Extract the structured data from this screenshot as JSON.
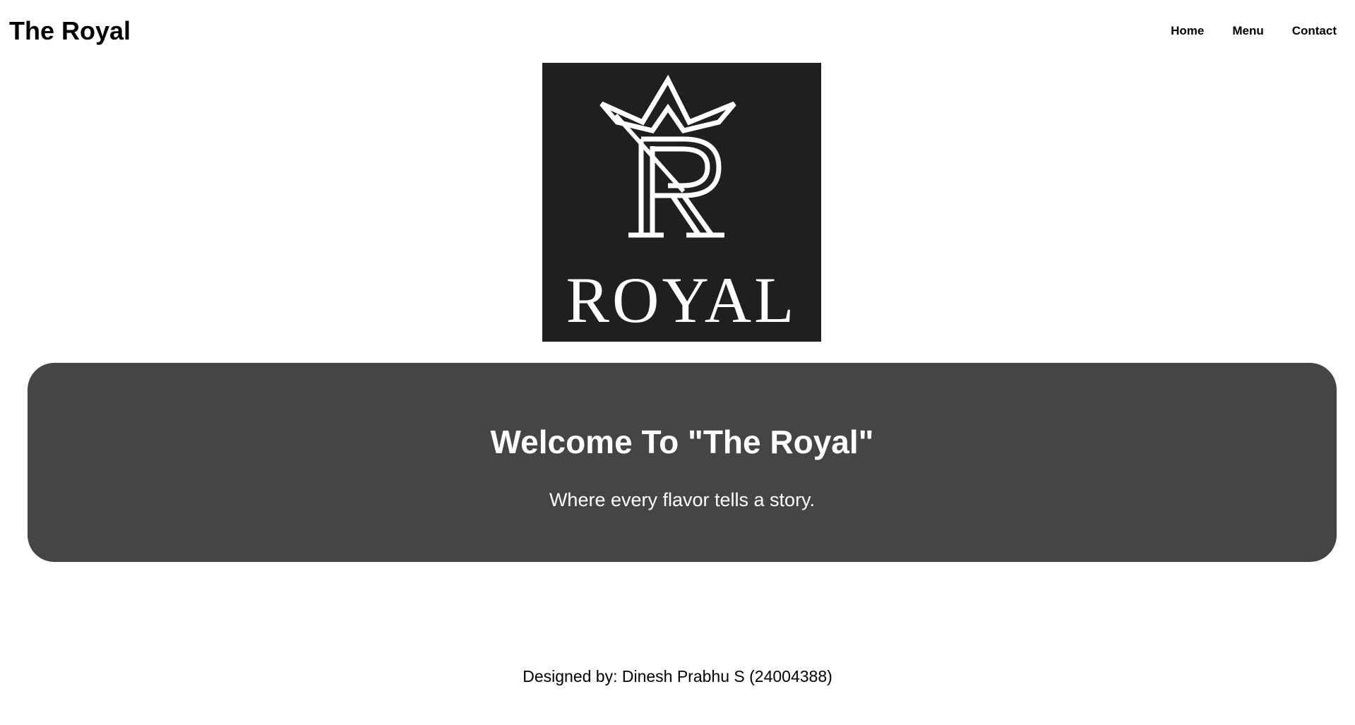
{
  "header": {
    "site_title": "The Royal",
    "nav": [
      {
        "label": "Home"
      },
      {
        "label": "Menu"
      },
      {
        "label": "Contact"
      }
    ]
  },
  "logo": {
    "wordmark": "ROYAL",
    "icon": "crown-r-monogram-icon",
    "background_color": "#1f1f20",
    "foreground_color": "#ffffff"
  },
  "hero": {
    "title": "Welcome To \"The Royal\"",
    "subtitle": "Where every flavor tells a story.",
    "background_color": "#444547"
  },
  "footer": {
    "credit": "Designed by: Dinesh Prabhu S (24004388)"
  }
}
